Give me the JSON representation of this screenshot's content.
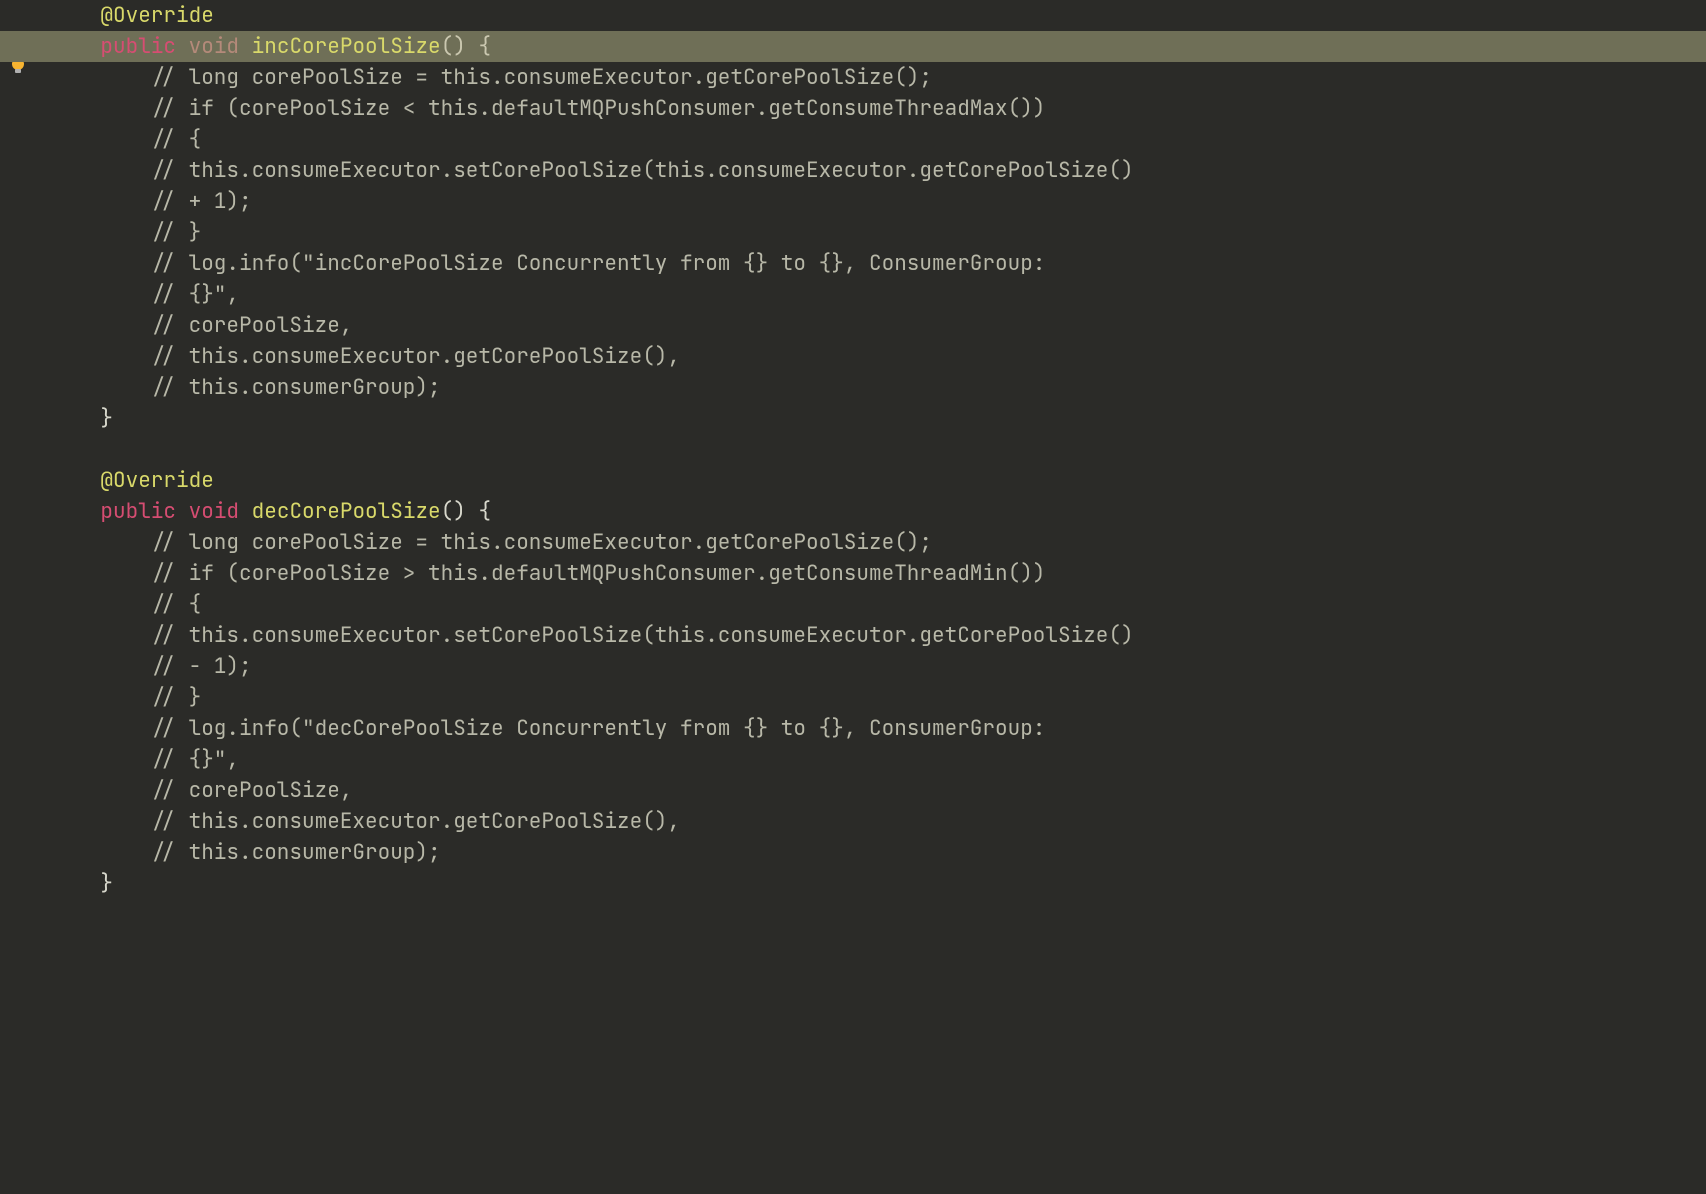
{
  "code": {
    "line1_annotation": "@Override",
    "line2_public": "public",
    "line2_void": "void",
    "line2_method": "incCorePoolSize",
    "line2_rest": "() {",
    "line3": "// long corePoolSize = this.consumeExecutor.getCorePoolSize();",
    "line4": "// if (corePoolSize < this.defaultMQPushConsumer.getConsumeThreadMax())",
    "line5": "// {",
    "line6": "// this.consumeExecutor.setCorePoolSize(this.consumeExecutor.getCorePoolSize()",
    "line7": "// + 1);",
    "line8": "// }",
    "line9": "// log.info(\"incCorePoolSize Concurrently from {} to {}, ConsumerGroup:",
    "line10": "// {}\",",
    "line11": "// corePoolSize,",
    "line12": "// this.consumeExecutor.getCorePoolSize(),",
    "line13": "// this.consumerGroup);",
    "line14": "}",
    "line15": "",
    "line16_annotation": "@Override",
    "line17_public": "public",
    "line17_void": "void",
    "line17_method": "decCorePoolSize",
    "line17_rest": "() {",
    "line18": "// long corePoolSize = this.consumeExecutor.getCorePoolSize();",
    "line19": "// if (corePoolSize > this.defaultMQPushConsumer.getConsumeThreadMin())",
    "line20": "// {",
    "line21": "// this.consumeExecutor.setCorePoolSize(this.consumeExecutor.getCorePoolSize()",
    "line22": "// - 1);",
    "line23": "// }",
    "line24": "// log.info(\"decCorePoolSize Concurrently from {} to {}, ConsumerGroup:",
    "line25": "// {}\",",
    "line26": "// corePoolSize,",
    "line27": "// this.consumeExecutor.getCorePoolSize(),",
    "line28": "// this.consumerGroup);",
    "line29": "}"
  },
  "indent": {
    "lvl1": "    ",
    "lvl2": "        "
  }
}
